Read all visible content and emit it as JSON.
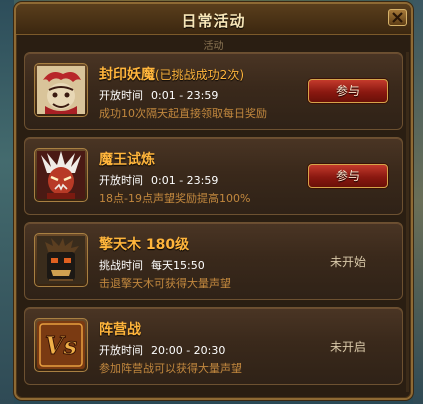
{
  "window": {
    "title": "日常活动",
    "tab_label": "活动"
  },
  "activities": [
    {
      "name": "封印妖魔",
      "name_extra": "(已挑战成功2次)",
      "time_label": "开放时间",
      "time_value": "0:01 - 23:59",
      "description": "成功10次隔天起直接领取每日奖励",
      "action_label": "参与",
      "icon": "demon-portrait-icon"
    },
    {
      "name": "魔王试炼",
      "name_extra": "",
      "time_label": "开放时间",
      "time_value": "0:01 - 23:59",
      "description": "18点-19点声望奖励提高100%",
      "action_label": "参与",
      "icon": "demon-king-portrait-icon"
    },
    {
      "name": "擎天木  180级",
      "name_extra": "",
      "time_label": "挑战时间",
      "time_value": "每天15:50",
      "description": "击退擎天木可获得大量声望",
      "status": "未开始",
      "icon": "tree-golem-icon"
    },
    {
      "name": "阵营战",
      "name_extra": "",
      "time_label": "开放时间",
      "time_value": "20:00 - 20:30",
      "description": "参加阵营战可以获得大量声望",
      "status": "未开启",
      "icon": "versus-icon"
    }
  ],
  "colors": {
    "activity_name": "#ffb53c",
    "description": "#c2883e",
    "join_button": "#8a1810",
    "frame_border": "#8e6a34"
  }
}
